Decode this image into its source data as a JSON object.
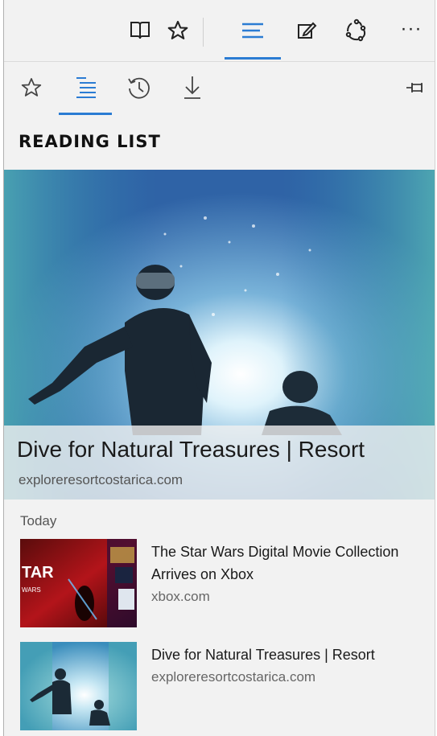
{
  "toolbar": {
    "icons": [
      "reading-view-icon",
      "favorite-star-icon",
      "hub-icon",
      "web-note-icon",
      "share-icon",
      "more-icon"
    ],
    "more_label": "···"
  },
  "hub": {
    "tabs": [
      "favorites",
      "reading-list",
      "history",
      "downloads"
    ],
    "active_tab": "reading-list",
    "section_title": "READING LIST",
    "accent_color": "#2b7cd3"
  },
  "featured": {
    "title": "Dive for Natural Treasures | Resort",
    "domain": "exploreresortcostarica.com"
  },
  "list": {
    "group_label": "Today",
    "items": [
      {
        "title": "The Star Wars Digital Movie Collection Arrives on Xbox",
        "domain": "xbox.com"
      },
      {
        "title": "Dive for Natural Treasures | Resort",
        "domain": "exploreresortcostarica.com"
      }
    ]
  }
}
